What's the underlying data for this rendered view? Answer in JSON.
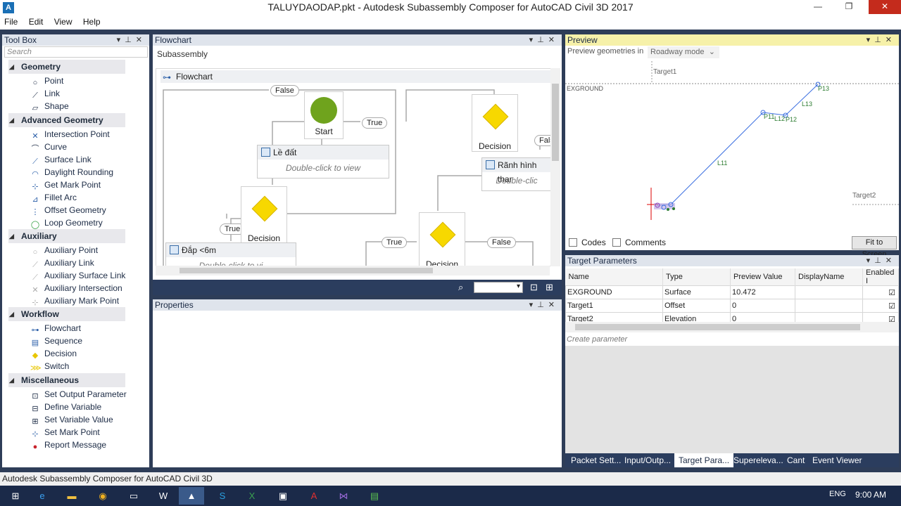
{
  "window": {
    "title": "TALUYDAODAP.pkt - Autodesk Subassembly Composer for AutoCAD Civil 3D 2017",
    "controls": [
      "—",
      "❐",
      "✕"
    ]
  },
  "menu": [
    "File",
    "Edit",
    "View",
    "Help"
  ],
  "toolbox": {
    "title": "Tool Box",
    "search_placeholder": "Search",
    "groups": [
      {
        "label": "Geometry",
        "items": [
          "Point",
          "Link",
          "Shape"
        ]
      },
      {
        "label": "Advanced Geometry",
        "items": [
          "Intersection Point",
          "Curve",
          "Surface Link",
          "Daylight Rounding",
          "Get Mark Point",
          "Fillet Arc",
          "Offset Geometry",
          "Loop Geometry"
        ]
      },
      {
        "label": "Auxiliary",
        "items": [
          "Auxiliary Point",
          "Auxiliary Link",
          "Auxiliary Surface Link",
          "Auxiliary Intersection",
          "Auxiliary Mark Point"
        ]
      },
      {
        "label": "Workflow",
        "items": [
          "Flowchart",
          "Sequence",
          "Decision",
          "Switch"
        ]
      },
      {
        "label": "Miscellaneous",
        "items": [
          "Set Output Parameter",
          "Define Variable",
          "Set Variable Value",
          "Set Mark Point",
          "Report Message"
        ]
      }
    ]
  },
  "flowchart": {
    "title": "Flowchart",
    "subassembly_label": "Subassembly",
    "canvas_header": "Flowchart",
    "start_label": "Start",
    "decision_label": "Decision",
    "activities": [
      {
        "title": "Lề đất",
        "body": "Double-click to view"
      },
      {
        "title": "Rãnh hình thar",
        "body": "Double-clic"
      },
      {
        "title": "Đắp <6m",
        "body": "Double-click to vi"
      }
    ],
    "pills": {
      "true": "True",
      "false": "False",
      "false_cut": "Fals"
    }
  },
  "properties": {
    "title": "Properties"
  },
  "preview": {
    "title": "Preview",
    "geometries_label": "Preview geometries in",
    "mode": "Roadway mode",
    "labels": {
      "target1": "Target1",
      "target2": "Target2",
      "exground": "EXGROUND",
      "l11": "L11",
      "l13": "L13",
      "p11": "P11",
      "l12": "L12",
      "p12": "P12",
      "p13": "P13"
    },
    "codes_label": "Codes",
    "comments_label": "Comments",
    "fit_label": "Fit to Screen"
  },
  "target_parameters": {
    "title": "Target Parameters",
    "columns": [
      "Name",
      "Type",
      "Preview Value",
      "DisplayName",
      "Enabled I"
    ],
    "rows": [
      {
        "name": "EXGROUND",
        "type": "Surface",
        "value": "10.472",
        "display": "",
        "enabled": true
      },
      {
        "name": "Target1",
        "type": "Offset",
        "value": "0",
        "display": "",
        "enabled": true
      },
      {
        "name": "Target2",
        "type": "Elevation",
        "value": "0",
        "display": "",
        "enabled": true
      }
    ],
    "create_label": "Create parameter"
  },
  "bottom_tabs": [
    "Packet Sett...",
    "Input/Outp...",
    "Target Para...",
    "Supereleva...",
    "Cant",
    "Event Viewer"
  ],
  "bottom_tab_selected": "Target Para...",
  "status": "Autodesk Subassembly Composer for AutoCAD Civil 3D",
  "taskbar": {
    "language": "ENG",
    "time": "9:00 AM"
  }
}
